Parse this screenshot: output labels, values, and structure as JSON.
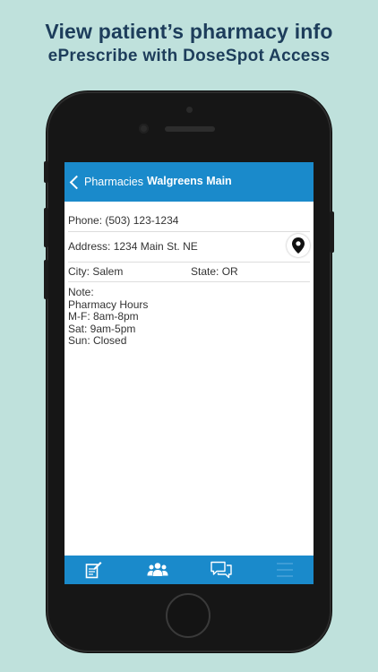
{
  "marketing": {
    "headline_line1": "View patient’s pharmacy info",
    "headline_line2": "ePrescribe with DoseSpot Access"
  },
  "navbar": {
    "back_label": "Pharmacies",
    "title": "Walgreens Main"
  },
  "details": {
    "phone": "Phone: (503) 123-1234",
    "address": "Address: 1234 Main St. NE",
    "city": "City: Salem",
    "state": "State: OR",
    "note_lines": [
      "Note:",
      "Pharmacy Hours",
      "M-F: 8am-8pm",
      "Sat: 9am-5pm",
      "Sun: Closed"
    ]
  },
  "icons": {
    "back": "chevron-left-icon",
    "address_action": "map-pin-icon",
    "tabs": [
      "prescription-icon",
      "patients-icon",
      "messages-icon",
      "menu-icon"
    ]
  },
  "colors": {
    "background": "#bfe1dc",
    "headline": "#1d3d5b",
    "brand_blue": "#1a8acb",
    "phone_body": "#161616"
  }
}
